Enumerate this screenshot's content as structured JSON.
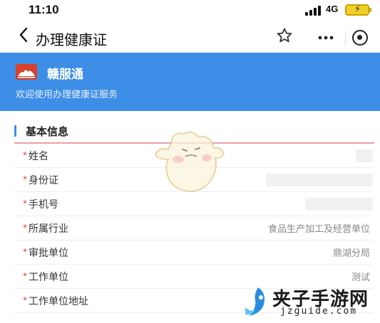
{
  "status_bar": {
    "time": "11:10",
    "network": "4G",
    "battery_charging": true
  },
  "nav": {
    "back_icon": "chevron-left-icon",
    "title": "办理健康证",
    "favorite_icon": "star-icon",
    "more_icon": "more-dots-icon",
    "close_icon": "target-close-icon"
  },
  "banner": {
    "brand_name": "赣服通",
    "subtitle": "欢迎使用办理健康证服务",
    "background_color": "#3d8ee6",
    "logo_color": "#d8402a"
  },
  "section": {
    "title": "基本信息",
    "accent_color": "#3d8ee6",
    "underline_color": "#e8a0a8"
  },
  "form": {
    "required_mark": "*",
    "fields": [
      {
        "label": "姓名",
        "value": "",
        "redacted": true
      },
      {
        "label": "身份证",
        "value": "",
        "redacted": true
      },
      {
        "label": "手机号",
        "value": "",
        "redacted": true
      },
      {
        "label": "所属行业",
        "value": "食品生产加工及经营单位",
        "redacted": false
      },
      {
        "label": "审批单位",
        "value": "鼎湖分局",
        "redacted": false
      },
      {
        "label": "工作单位",
        "value": "测试",
        "redacted": false
      },
      {
        "label": "工作单位地址",
        "value": "",
        "redacted": false
      }
    ]
  },
  "watermark": {
    "text": "夹子手游网",
    "url": "jzguide.com"
  }
}
